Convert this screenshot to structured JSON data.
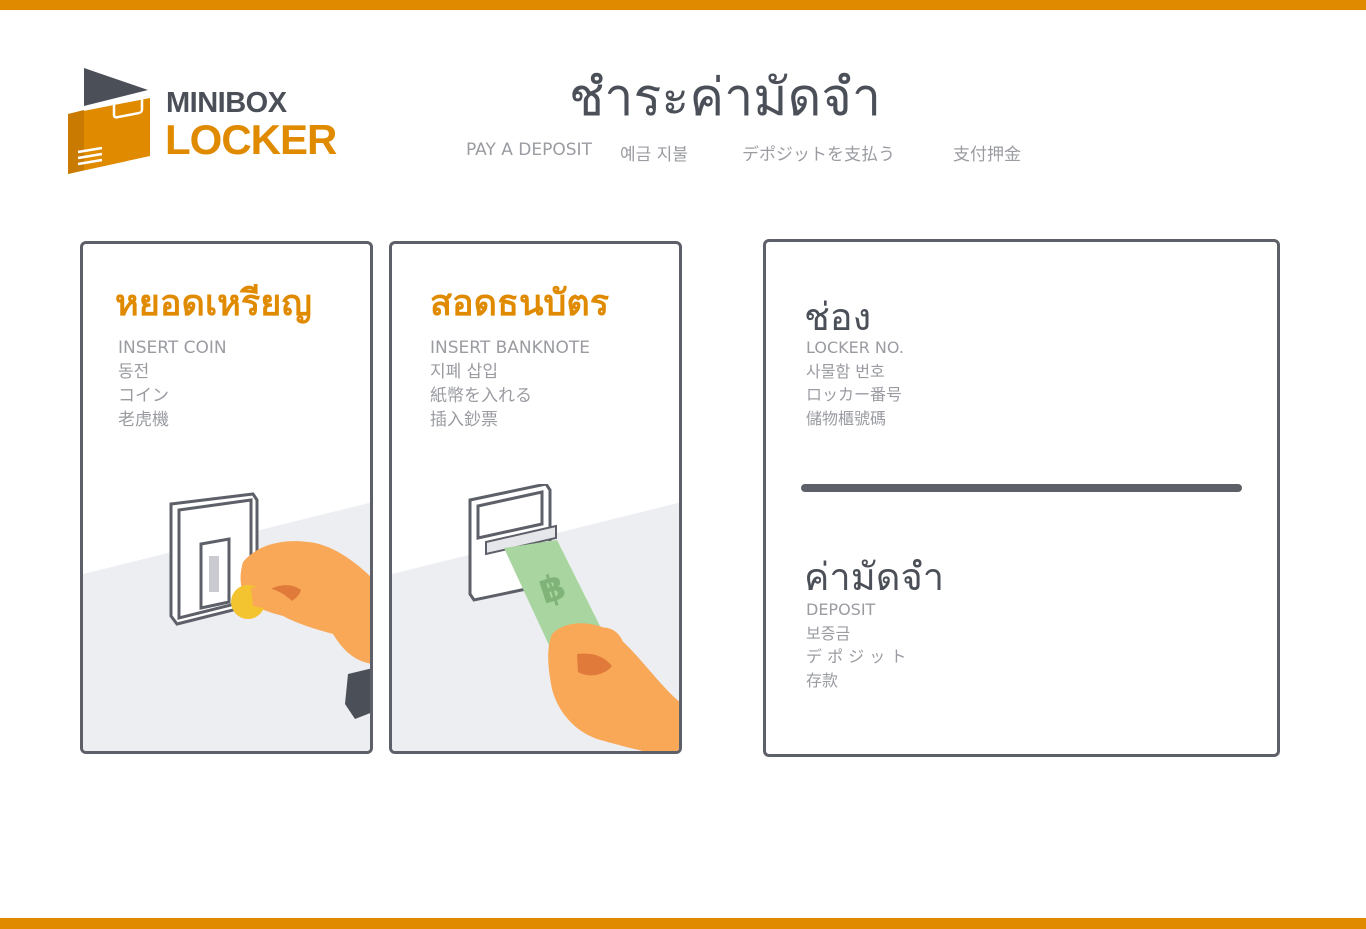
{
  "brand": {
    "line1": "MINIBOX",
    "line2": "LOCKER",
    "colors": {
      "accent": "#e08a00",
      "dark": "#4b4f58",
      "muted": "#9a9ca2"
    }
  },
  "header": {
    "title": "ชำระค่ามัดจำ",
    "subtitles": [
      "PAY A DEPOSIT",
      "예금 지불",
      "デポジットを支払う",
      "支付押金"
    ]
  },
  "coin_card": {
    "title": "หยอดเหรียญ",
    "labels": [
      "INSERT COIN",
      "동전",
      "コイン",
      "老虎機"
    ],
    "icon": "coin-slot-icon"
  },
  "note_card": {
    "title": "สอดธนบัตร",
    "labels": [
      "INSERT BANKNOTE",
      "지폐 삽입",
      "紙幣を入れる",
      "插入鈔票"
    ],
    "icon": "banknote-slot-icon"
  },
  "locker_card": {
    "locker_title": "ช่อง",
    "locker_labels": [
      "LOCKER NO.",
      "사물함 번호",
      "ロッカー番号",
      "儲物櫃號碼"
    ],
    "deposit_title": "ค่ามัดจำ",
    "deposit_labels": [
      "DEPOSIT",
      "보증금",
      "デ ポ ジ ッ ト",
      "存款"
    ]
  }
}
